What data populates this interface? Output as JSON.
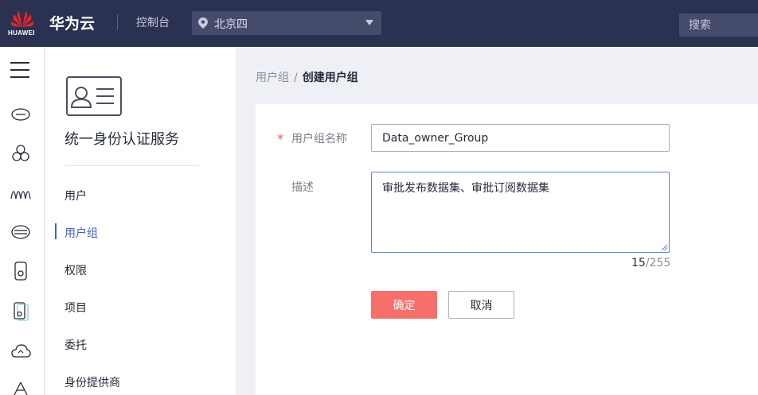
{
  "header": {
    "logo_text": "HUAWEI",
    "brand": "华为云",
    "console_link": "控制台",
    "region": "北京四",
    "search_placeholder": "搜索"
  },
  "sidenav": {
    "service_title": "统一身份认证服务",
    "items": [
      {
        "label": "用户"
      },
      {
        "label": "用户组"
      },
      {
        "label": "权限"
      },
      {
        "label": "项目"
      },
      {
        "label": "委托"
      },
      {
        "label": "身份提供商"
      }
    ],
    "active_item": "用户组"
  },
  "breadcrumb": {
    "parent": "用户组",
    "separator": "/",
    "current": "创建用户组"
  },
  "form": {
    "required_mark": "*",
    "name_label": "用户组名称",
    "name_value": "Data_owner_Group",
    "desc_label": "描述",
    "desc_value": "审批发布数据集、审批订阅数据集",
    "char_count": "15",
    "char_limit": "/255",
    "ok_label": "确定",
    "cancel_label": "取消"
  },
  "colors": {
    "topbar": "#2b3150",
    "primary_button": "#f66f6a",
    "active_nav": "#3f62c7",
    "focus_border": "#5e7ce0"
  }
}
